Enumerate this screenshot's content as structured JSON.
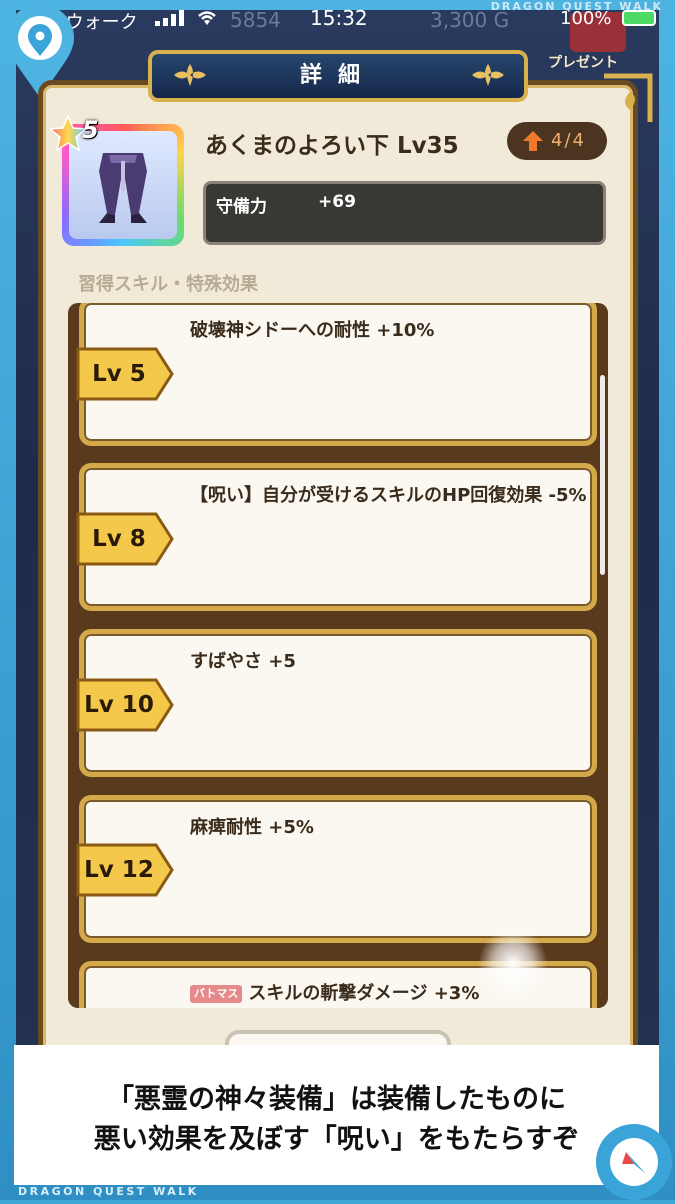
{
  "status_bar": {
    "carrier": "◀ DQウォーク",
    "time": "15:32",
    "battery": "100%",
    "brand": "DRAGON QUEST WALK"
  },
  "background": {
    "gems": "5854",
    "money": "3,300 G",
    "present": "プレゼント"
  },
  "dialog": {
    "title": "詳細",
    "item": {
      "rarity_star": "5",
      "name": "あくまのよろい下 Lv35",
      "upgrade": "4/4",
      "stat_label": "守備力",
      "stat_value": "+69"
    },
    "section_label": "習得スキル・特殊効果",
    "skills": [
      {
        "lv": "Lv 5",
        "text": "破壊神シドーへの耐性 +10%"
      },
      {
        "lv": "Lv 8",
        "text": "【呪い】自分が受けるスキルのHP回復効果 -5%"
      },
      {
        "lv": "Lv 10",
        "text": "すばやさ +5"
      },
      {
        "lv": "Lv 12",
        "text": "麻痺耐性 +5%"
      },
      {
        "lv": "",
        "tag": "バトマス",
        "text": "スキルの斬撃ダメージ +3%"
      }
    ]
  },
  "caption": {
    "line1": "「悪霊の神々装備」は装備したものに",
    "line2": "悪い効果を及ぼす「呪い」をもたらすぞ"
  },
  "footer": {
    "brand": "DRAGON QUEST WALK"
  },
  "icons": {
    "pin": "location-pin-icon",
    "compass": "compass-icon",
    "upgrade": "arrow-up-icon"
  },
  "colors": {
    "panel_bg": "#f2ead8",
    "frame_gold": "#d3a94a",
    "title_navy": "#1c3558",
    "lv_tag_gold": "#f4c84a",
    "accent_blue": "#3aa3d8"
  }
}
